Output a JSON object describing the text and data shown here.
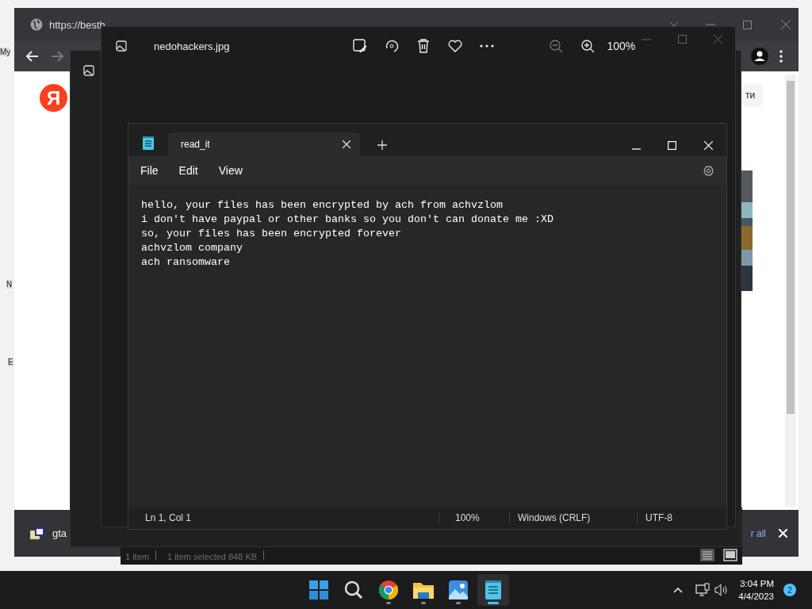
{
  "desktop": {
    "icon_labels": [
      "My",
      "N",
      "E"
    ]
  },
  "browser": {
    "tab_url": "https://besth",
    "logo": "Я",
    "page_button": "ти",
    "download_bar": {
      "file": "gta",
      "show_all": "r all"
    }
  },
  "explorer": {
    "status": [
      "1 item",
      "1 item selected  848 KB"
    ]
  },
  "photo_viewer": {
    "title": "nedohackers.jpg",
    "zoom": "100%"
  },
  "notepad": {
    "tabs": [
      {
        "label": "read_it",
        "selected": true
      }
    ],
    "menu": [
      "File",
      "Edit",
      "View"
    ],
    "lines": [
      "hello, your files has been encrypted by ach from achvzlom",
      "i don't have paypal or other banks so you don't can donate me :XD",
      "so, your files has been encrypted forever",
      "achvzlom company",
      "ach ransomware"
    ],
    "status": {
      "position": "Ln 1, Col 1",
      "zoom": "100%",
      "line_ending": "Windows (CRLF)",
      "encoding": "UTF-8"
    }
  },
  "taskbar": {
    "apps": [
      {
        "kind": "start",
        "running": false,
        "selected": false
      },
      {
        "kind": "search",
        "running": false,
        "selected": false
      },
      {
        "kind": "chrome",
        "running": true,
        "selected": false
      },
      {
        "kind": "explorer",
        "running": true,
        "selected": false
      },
      {
        "kind": "photos",
        "running": true,
        "selected": false
      },
      {
        "kind": "notepad",
        "running": true,
        "selected": true
      }
    ],
    "time": "3:04 PM",
    "date": "4/4/2023",
    "notifications": "2"
  }
}
